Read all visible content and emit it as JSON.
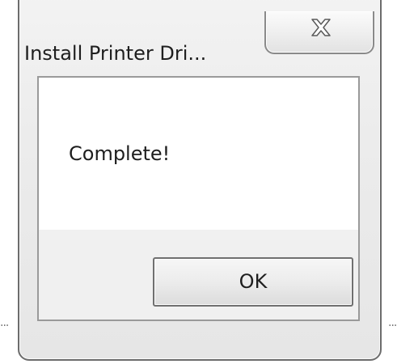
{
  "dialog": {
    "title": "Install Printer Dri...",
    "message": "Complete!",
    "ok_label": "OK",
    "close_icon": "close-icon"
  },
  "colors": {
    "window_border": "#6c6c6c",
    "client_border": "#9a9a9a",
    "message_background": "#ffffff",
    "button_area_background": "#f0f0f0",
    "text": "#1e1e1e"
  }
}
